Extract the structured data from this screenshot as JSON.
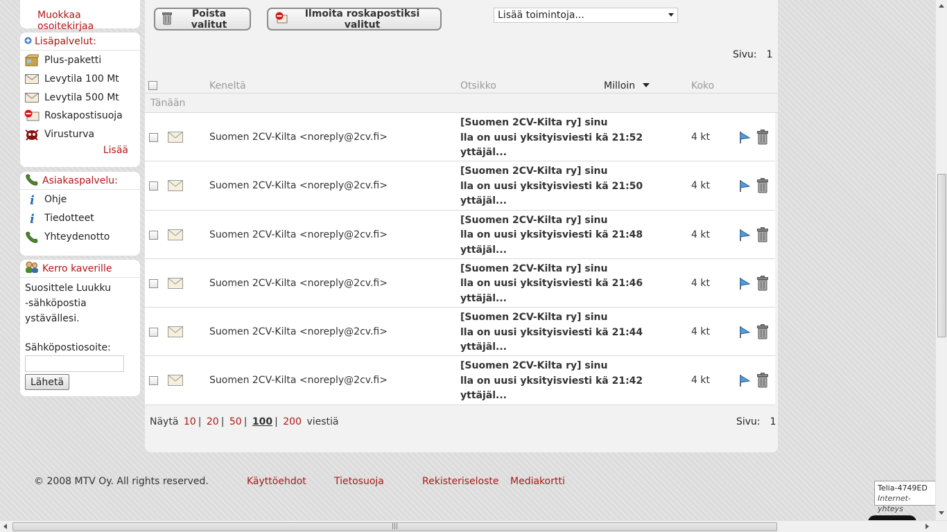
{
  "sidebar": {
    "edit_address_book": "Muokkaa osoitekirjaa",
    "services": {
      "title": "Lisäpalvelut:",
      "items": [
        {
          "label": "Plus-paketti",
          "icon": "package-icon"
        },
        {
          "label": "Levytila 100 Mt",
          "icon": "envelope-icon"
        },
        {
          "label": "Levytila 500 Mt",
          "icon": "envelope-icon"
        },
        {
          "label": "Roskapostisuoja",
          "icon": "spam-icon"
        },
        {
          "label": "Virusturva",
          "icon": "virus-icon"
        }
      ],
      "more": "Lisää"
    },
    "support": {
      "title": "Asiakaspalvelu:",
      "items": [
        {
          "label": "Ohje",
          "icon": "info-icon"
        },
        {
          "label": "Tiedotteet",
          "icon": "info-icon"
        },
        {
          "label": "Yhteydenotto",
          "icon": "phone-icon"
        }
      ]
    },
    "tell": {
      "title": "Kerro kaverille",
      "text_line1": "Suosittele Luukku",
      "text_line2": "-sähköpostia ystävällesi.",
      "email_label": "Sähköpostiosoite:",
      "email_value": "",
      "send": "Lähetä"
    }
  },
  "toolbar": {
    "delete_selected": "Poista valitut",
    "report_spam": "Ilmoita roskapostiksi valitut",
    "more_actions": "Lisää toimintoja..."
  },
  "page_label": "Sivu:",
  "page_number": "1",
  "table": {
    "headers": {
      "from": "Keneltä",
      "subject": "Otsikko",
      "when": "Milloin",
      "size": "Koko"
    },
    "group": "Tänään",
    "rows": [
      {
        "from": "Suomen 2CV-Kilta <noreply@2cv.fi>",
        "subject_l1": "[Suomen 2CV-Kilta ry] sinu",
        "subject_l2": "lla on uusi yksityisviesti kä 21:52",
        "subject_l3": "yttäjäl...",
        "size": "4 kt"
      },
      {
        "from": "Suomen 2CV-Kilta <noreply@2cv.fi>",
        "subject_l1": "[Suomen 2CV-Kilta ry] sinu",
        "subject_l2": "lla on uusi yksityisviesti kä 21:50",
        "subject_l3": "yttäjäl...",
        "size": "4 kt"
      },
      {
        "from": "Suomen 2CV-Kilta <noreply@2cv.fi>",
        "subject_l1": "[Suomen 2CV-Kilta ry] sinu",
        "subject_l2": "lla on uusi yksityisviesti kä 21:48",
        "subject_l3": "yttäjäl...",
        "size": "4 kt"
      },
      {
        "from": "Suomen 2CV-Kilta <noreply@2cv.fi>",
        "subject_l1": "[Suomen 2CV-Kilta ry] sinu",
        "subject_l2": "lla on uusi yksityisviesti kä 21:46",
        "subject_l3": "yttäjäl...",
        "size": "4 kt"
      },
      {
        "from": "Suomen 2CV-Kilta <noreply@2cv.fi>",
        "subject_l1": "[Suomen 2CV-Kilta ry] sinu",
        "subject_l2": "lla on uusi yksityisviesti kä 21:44",
        "subject_l3": "yttäjäl...",
        "size": "4 kt"
      },
      {
        "from": "Suomen 2CV-Kilta <noreply@2cv.fi>",
        "subject_l1": "[Suomen 2CV-Kilta ry] sinu",
        "subject_l2": "lla on uusi yksityisviesti kä 21:42",
        "subject_l3": "yttäjäl...",
        "size": "4 kt"
      }
    ]
  },
  "pager": {
    "show": "Näytä",
    "options": [
      "10",
      "20",
      "50",
      "100",
      "200"
    ],
    "current": "100",
    "suffix": "viestiä"
  },
  "footer": {
    "copyright": "© 2008 MTV Oy. All rights reserved.",
    "links": [
      "Käyttöehdot",
      "Tietosuoja",
      "Rekisteriseloste",
      "Mediakortti"
    ]
  },
  "tooltip": {
    "line1": "Telia-4749ED",
    "line2": "Internet-yhteys"
  },
  "colors": {
    "accent": "#b01515",
    "panel": "#f2f2f2",
    "background": "#dcdcdc"
  }
}
